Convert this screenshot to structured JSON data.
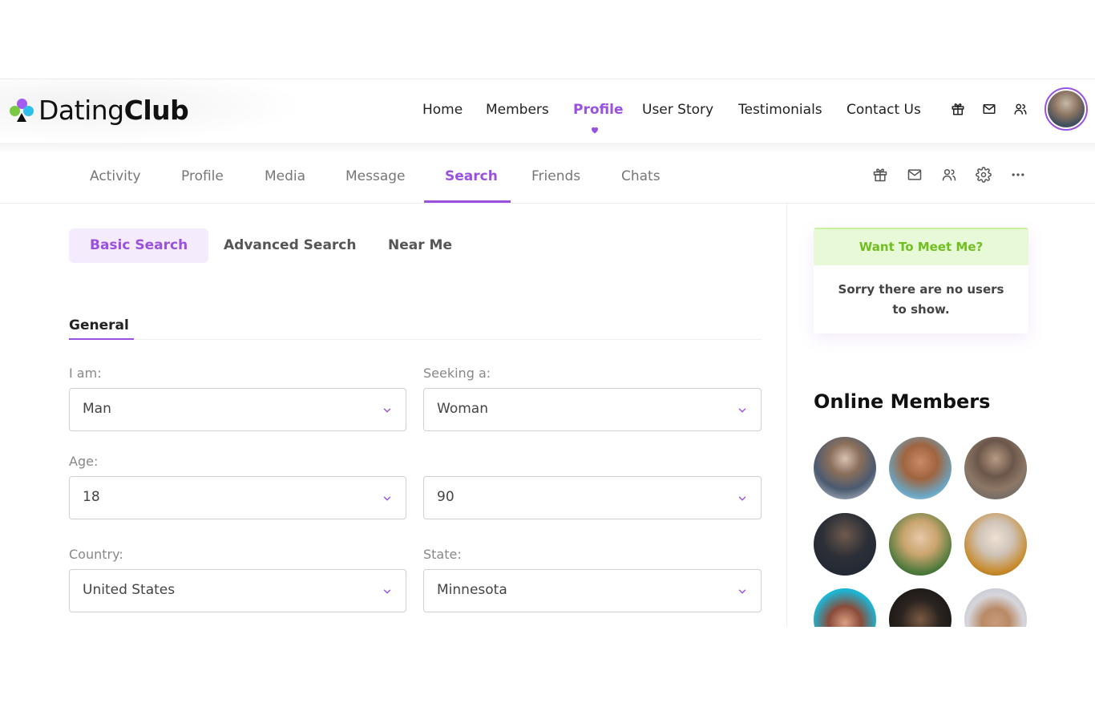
{
  "logo": {
    "part1": "Dating",
    "part2": "Club"
  },
  "main_nav": {
    "items": [
      {
        "label": "Home"
      },
      {
        "label": "Members"
      },
      {
        "label": "Profile"
      },
      {
        "label": "User Story"
      },
      {
        "label": "Testimonials"
      },
      {
        "label": "Contact Us"
      }
    ],
    "active": "Profile",
    "icons": [
      "gift-icon",
      "mail-icon",
      "users-icon"
    ]
  },
  "sub_nav": {
    "tabs": [
      {
        "label": "Activity"
      },
      {
        "label": "Profile"
      },
      {
        "label": "Media"
      },
      {
        "label": "Message"
      },
      {
        "label": "Search"
      },
      {
        "label": "Friends"
      },
      {
        "label": "Chats"
      }
    ],
    "active": "Search",
    "icons": [
      "gift-icon",
      "mail-icon",
      "users-icon",
      "gear-icon",
      "more-icon"
    ]
  },
  "search": {
    "tabs": [
      {
        "label": "Basic Search"
      },
      {
        "label": "Advanced Search"
      },
      {
        "label": "Near Me"
      }
    ],
    "active_tab": "Basic Search",
    "section": "General",
    "fields": {
      "i_am": {
        "label": "I am:",
        "value": "Man"
      },
      "seeking": {
        "label": "Seeking a:",
        "value": "Woman"
      },
      "age": {
        "label": "Age:",
        "min": "18",
        "max": "90"
      },
      "country": {
        "label": "Country:",
        "value": "United States"
      },
      "state": {
        "label": "State:",
        "value": "Minnesota"
      }
    }
  },
  "sidebar": {
    "meet_card": {
      "title": "Want To Meet Me?",
      "message": "Sorry there are no users to show."
    },
    "online_title": "Online Members",
    "members_count_visible": 9
  },
  "colors": {
    "accent": "#9b51e0",
    "accent_light": "#f4ecfd",
    "meet_green": "#6fbf1f",
    "meet_green_bg": "#e8f9d8"
  }
}
